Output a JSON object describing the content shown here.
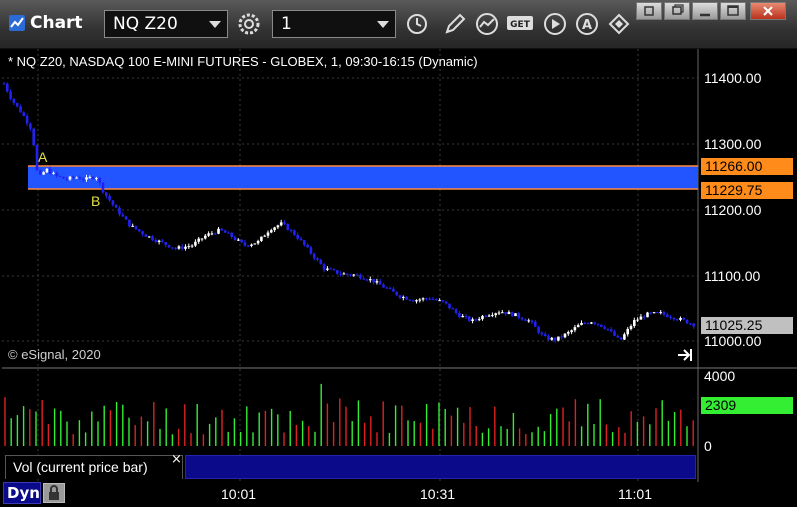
{
  "window": {
    "title": "Chart",
    "symbol": "NQ Z20",
    "interval": "1"
  },
  "chart": {
    "header": "* NQ Z20, NASDAQ 100 E-MINI FUTURES - GLOBEX, 1, 09:30-16:15 (Dynamic)",
    "copyright": "© eSignal, 2020",
    "price_axis_labels": [
      "11400.00",
      "11300.00",
      "11200.00",
      "11100.00",
      "11000.00"
    ],
    "price_tags": {
      "upper": "11266.00",
      "lower": "11229.75",
      "last": "11025.25"
    },
    "markers": {
      "a": "A",
      "b": "B"
    },
    "time_labels": [
      "10:01",
      "10:31",
      "11:01"
    ],
    "colors": {
      "up_candle": "#ffffff",
      "down_candle": "#2222ee",
      "zone_fill": "#2255ff",
      "zone_line": "#ff8a3a",
      "tag_orange": "#ff8c1a",
      "tag_gray": "#c0c0c0",
      "vol_green": "#33ee33"
    }
  },
  "volume": {
    "label": "Vol (current price bar)",
    "close_glyph": "×",
    "axis_labels": [
      "4000",
      "0"
    ],
    "current": "2309"
  },
  "footer": {
    "mode": "Dyn"
  }
}
